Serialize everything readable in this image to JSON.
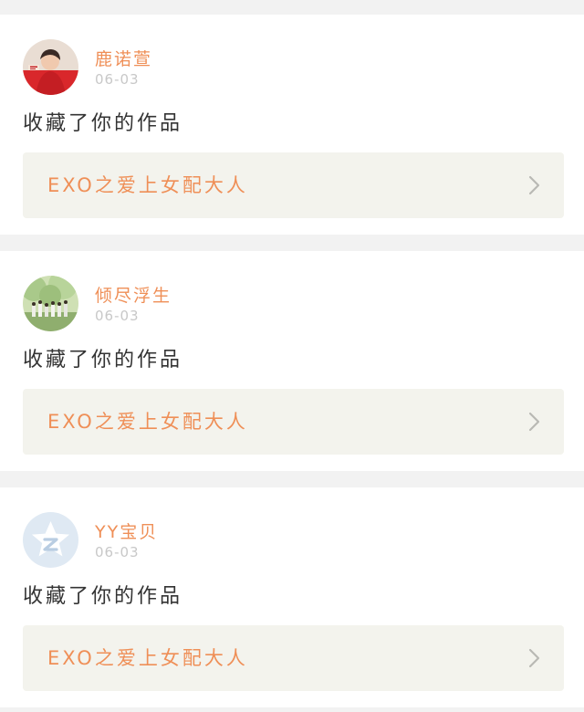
{
  "notifications": [
    {
      "username": "鹿诺萱",
      "date": "06-03",
      "action": "收藏了你的作品",
      "work_title": "EXO之爱上女配大人",
      "avatar_icon": "user-photo-avatar-icon"
    },
    {
      "username": "倾尽浮生",
      "date": "06-03",
      "action": "收藏了你的作品",
      "work_title": "EXO之爱上女配大人",
      "avatar_icon": "user-photo-avatar-icon"
    },
    {
      "username": "YY宝贝",
      "date": "06-03",
      "action": "收藏了你的作品",
      "work_title": "EXO之爱上女配大人",
      "avatar_icon": "default-star-avatar-icon"
    }
  ],
  "colors": {
    "accent": "#ef8f57",
    "date": "#c8c8c8",
    "text": "#333333",
    "link_bg": "#f3f3ed",
    "page_bg": "#f2f2f2"
  }
}
